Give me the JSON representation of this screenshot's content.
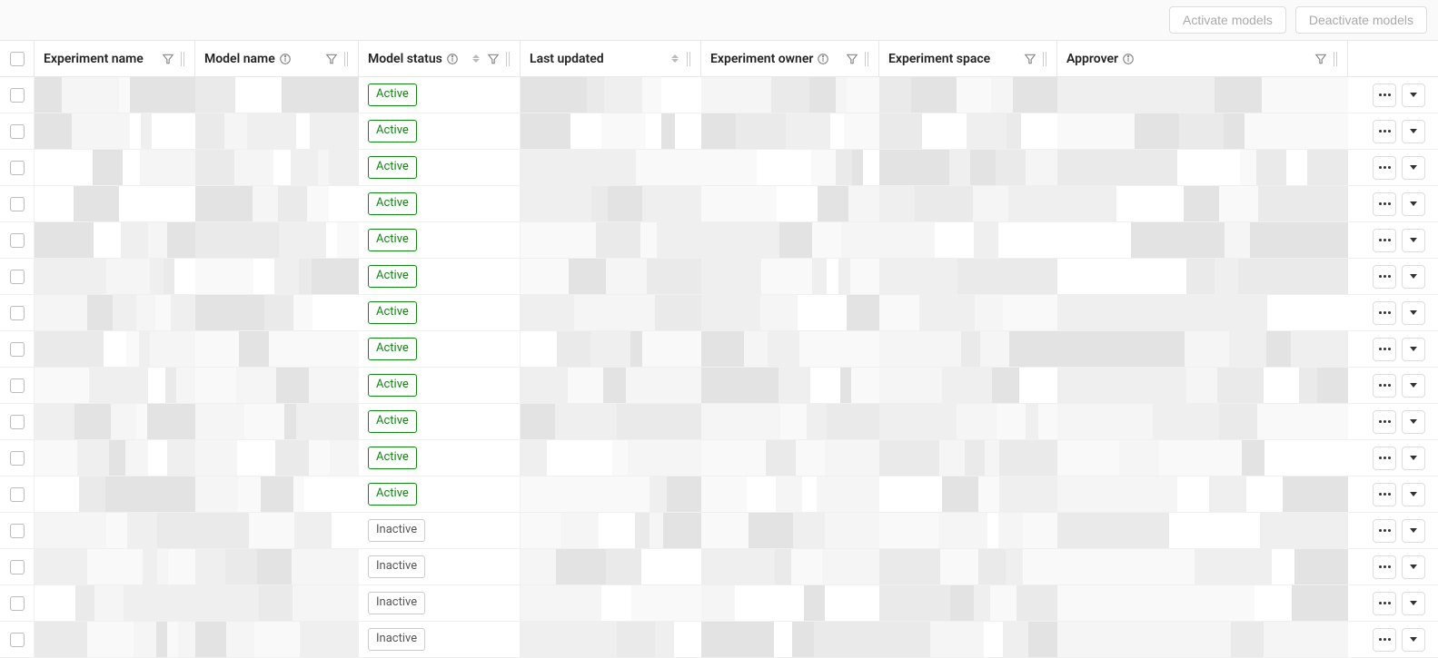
{
  "toolbar": {
    "activate_label": "Activate models",
    "deactivate_label": "Deactivate models"
  },
  "columns": {
    "experiment_name": "Experiment name",
    "model_name": "Model name",
    "model_status": "Model status",
    "last_updated": "Last updated",
    "experiment_owner": "Experiment owner",
    "experiment_space": "Experiment space",
    "approver": "Approver"
  },
  "status_labels": {
    "active": "Active",
    "inactive": "Inactive"
  },
  "rows": [
    {
      "status": "active"
    },
    {
      "status": "active"
    },
    {
      "status": "active"
    },
    {
      "status": "active"
    },
    {
      "status": "active"
    },
    {
      "status": "active"
    },
    {
      "status": "active"
    },
    {
      "status": "active"
    },
    {
      "status": "active"
    },
    {
      "status": "active"
    },
    {
      "status": "active"
    },
    {
      "status": "active"
    },
    {
      "status": "inactive"
    },
    {
      "status": "inactive"
    },
    {
      "status": "inactive"
    },
    {
      "status": "inactive"
    }
  ],
  "placeholder_shades": [
    "#f5f5f5",
    "#efefef",
    "#eaeaea",
    "#e3e3e3",
    "#f9f9f9",
    "#ffffff"
  ]
}
